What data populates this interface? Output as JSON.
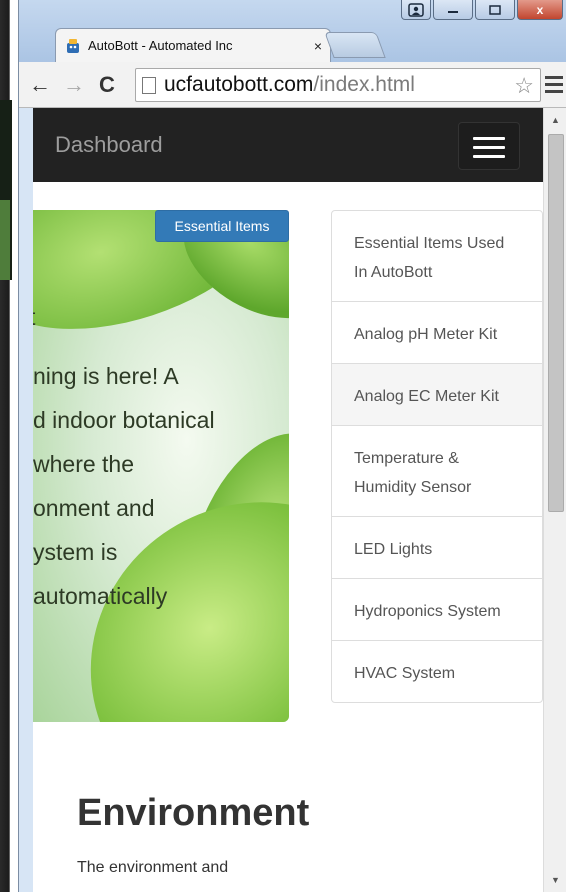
{
  "browser": {
    "tab_title": "AutoBott - Automated Inc",
    "tab_close": "×",
    "url_domain": "ucfautobott.com",
    "url_path": "/index.html",
    "back_icon": "←",
    "forward_icon": "→",
    "reload_icon": "C",
    "star_icon": "☆",
    "window_close": "x"
  },
  "navbar": {
    "brand": "Dashboard"
  },
  "hero": {
    "badge": "Essential Items",
    "partial_letter": "t",
    "lines": [
      "ning is here! A",
      "d indoor botanical",
      "where the",
      "onment and",
      "ystem is",
      " automatically"
    ]
  },
  "list_group": {
    "items": [
      {
        "label": "Essential Items Used In AutoBott"
      },
      {
        "label": "Analog pH Meter Kit"
      },
      {
        "label": "Analog EC Meter Kit"
      },
      {
        "label": "Temperature & Humidity Sensor"
      },
      {
        "label": "LED Lights"
      },
      {
        "label": "Hydroponics System"
      },
      {
        "label": "HVAC System"
      }
    ]
  },
  "environment": {
    "heading": "Environment",
    "text": "The environment and"
  },
  "colors": {
    "navbar_bg": "#222222",
    "badge_bg": "#337ab7",
    "accent_green": "#6db536"
  }
}
